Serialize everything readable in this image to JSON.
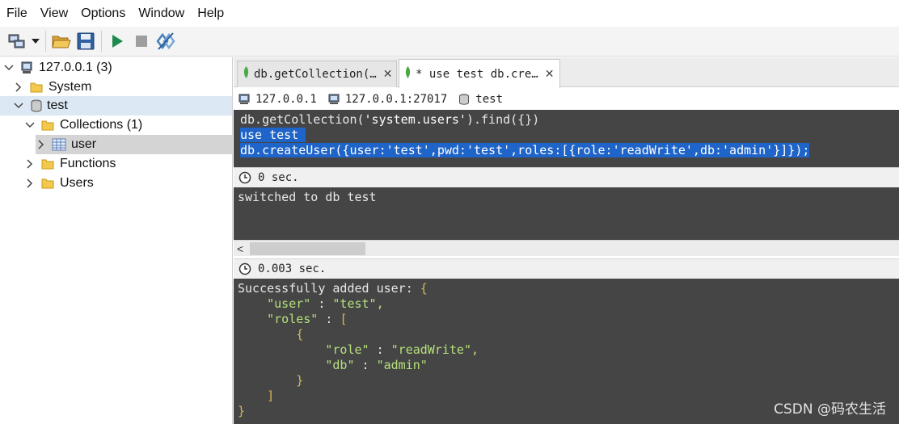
{
  "menubar": {
    "items": [
      "File",
      "View",
      "Options",
      "Window",
      "Help"
    ]
  },
  "toolbar": {
    "buttons": [
      "connect-icon",
      "dropdown-arrow-icon",
      "open-folder-icon",
      "save-icon",
      "execute-icon",
      "stop-icon",
      "format-icon"
    ]
  },
  "tree": {
    "server": "127.0.0.1 (3)",
    "system": "System",
    "db_test": "test",
    "collections": "Collections (1)",
    "user_collection": "user",
    "functions": "Functions",
    "users": "Users"
  },
  "tabs": [
    {
      "label": "db.getCollection(…"
    },
    {
      "label": "* use test  db.cre…"
    }
  ],
  "connection": {
    "server": "127.0.0.1",
    "address": "127.0.0.1:27017",
    "database": "test"
  },
  "editor": {
    "line1_a": "db.getCollection(",
    "line1_str": "'system.users'",
    "line1_b": ").find({})",
    "line2": "use test ",
    "line3": "db.createUser({user:'test',pwd:'test',roles:[{role:'readWrite',db:'admin'}]});"
  },
  "result1": {
    "time": "0 sec.",
    "output": "switched to db test"
  },
  "result2": {
    "time": "0.003 sec.",
    "lines": {
      "l1_a": "Successfully added user: ",
      "l1_b": "{",
      "l2_key": "\"user\"",
      "l2_sep": " : ",
      "l2_val": "\"test\",",
      "l3_key": "\"roles\"",
      "l3_sep": " : ",
      "l3_val": "[",
      "l4": "{",
      "l5_key": "\"role\"",
      "l5_sep": " : ",
      "l5_val": "\"readWrite\",",
      "l6_key": "\"db\"",
      "l6_sep": " : ",
      "l6_val": "\"admin\"",
      "l7": "}",
      "l8": "]",
      "l9": "}"
    }
  },
  "watermark": "CSDN @码农生活",
  "colors": {
    "editor_bg": "#454545",
    "selection": "#1f64c8",
    "json_key": "#b6e07c",
    "brace": "#d5b659"
  }
}
